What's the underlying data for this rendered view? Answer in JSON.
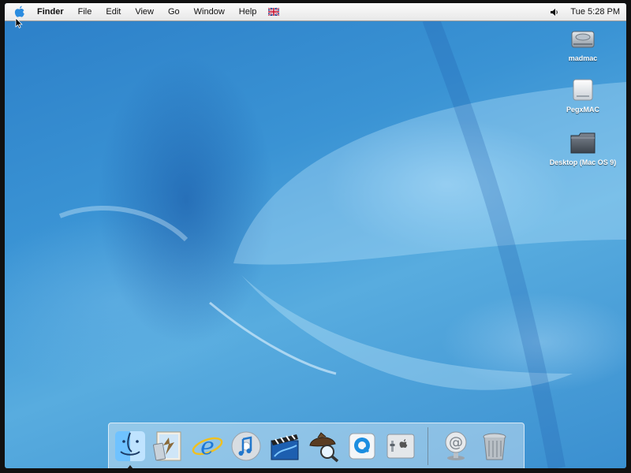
{
  "menubar": {
    "apple_icon": "apple-icon",
    "items": [
      "Finder",
      "File",
      "Edit",
      "View",
      "Go",
      "Window",
      "Help"
    ],
    "keyboard_flag_icon": "flag-icon",
    "volume_icon": "speaker-icon",
    "clock": "Tue 5:28 PM"
  },
  "desktop": {
    "icons": [
      {
        "label": "madmac",
        "icon": "hard-drive-icon"
      },
      {
        "label": "PegxMAC",
        "icon": "external-drive-icon"
      },
      {
        "label": "Desktop (Mac OS 9)",
        "icon": "folder-icon"
      }
    ]
  },
  "dock": {
    "items": [
      {
        "name": "Finder",
        "icon": "finder-icon",
        "running": true
      },
      {
        "name": "Mail",
        "icon": "mail-icon"
      },
      {
        "name": "Internet Explorer",
        "icon": "internet-explorer-icon"
      },
      {
        "name": "iTunes",
        "icon": "itunes-icon"
      },
      {
        "name": "iMovie",
        "icon": "imovie-icon"
      },
      {
        "name": "Sherlock",
        "icon": "sherlock-icon"
      },
      {
        "name": "QuickTime",
        "icon": "quicktime-icon"
      },
      {
        "name": "System Preferences",
        "icon": "system-preferences-icon"
      },
      {
        "name": "Mail Access",
        "icon": "at-sign-icon"
      },
      {
        "name": "Trash",
        "icon": "trash-icon"
      }
    ]
  },
  "colors": {
    "desktop_blue": "#3a93d4",
    "menubar": "#f2f2f2",
    "apple_blue": "#2a8ce0"
  }
}
